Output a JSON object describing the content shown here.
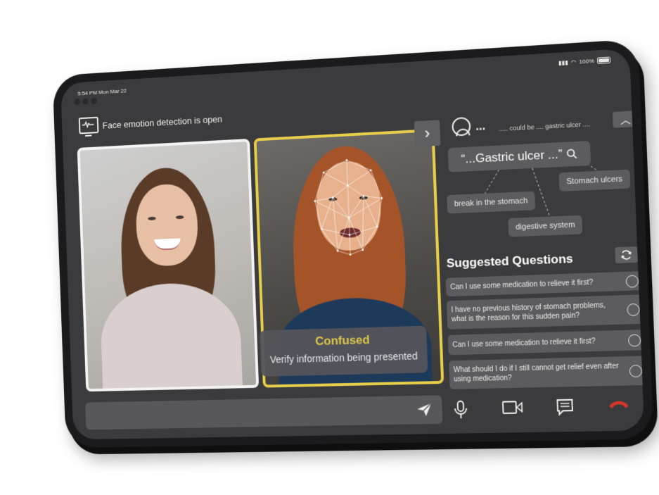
{
  "status_bar": {
    "time": "5:54 PM  Mon Mar 22",
    "battery": "100%"
  },
  "detection": {
    "label": "Face emotion detection is open",
    "icon": "monitor-heartbeat-icon"
  },
  "emotion": {
    "title": "Confused",
    "subtitle": "Verify information being presented",
    "accent": "#e8cf4b"
  },
  "transcript": {
    "ellipsis": "...",
    "text": "..... could be .... gastric ulcer ...."
  },
  "keywords": {
    "main": "“...Gastric ulcer ...”",
    "related": [
      "Stomach ulcers",
      "break in the stomach",
      "digestive system"
    ]
  },
  "suggested": {
    "title": "Suggested Questions",
    "questions": [
      "Can I use some medication to relieve it first?",
      "I have no previous history of stomach problems, what is the reason for this sudden pain?",
      "Can I use some medication to relieve it first?",
      "What should I do if I still cannot get relief even after using medication?"
    ]
  },
  "message": {
    "placeholder": ""
  },
  "colors": {
    "screen_bg": "#3b3b3d",
    "chip_bg": "#5c5c5f",
    "hangup": "#d9342b"
  }
}
